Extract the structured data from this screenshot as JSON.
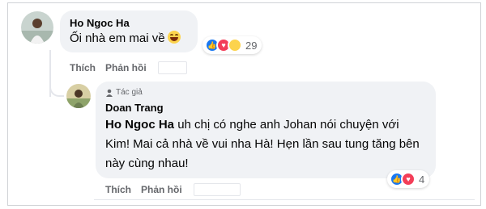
{
  "comment1": {
    "author": "Ho Ngoc Ha",
    "text": "Ối nhà em mai về",
    "emoji": "rolling-laughing-emoji",
    "reactions": [
      "like",
      "love",
      "haha"
    ],
    "reaction_count": "29",
    "actions": {
      "like": "Thích",
      "reply": "Phản hồi"
    }
  },
  "comment2": {
    "badge": "Tác giả",
    "author": "Doan Trang",
    "mention": "Ho Ngoc Ha",
    "text": "uh chị có nghe anh Johan nói chuyện với Kim! Mai cả nhà về vui nha Hà! Hẹn lần sau tung tăng bên này cùng nhau!",
    "reactions": [
      "like",
      "love"
    ],
    "reaction_count": "4",
    "actions": {
      "like": "Thích",
      "reply": "Phản hồi"
    }
  },
  "colors": {
    "bubble": "#f0f2f5",
    "like": "#1877f2",
    "love": "#f33e58",
    "secondary_text": "#65676b"
  }
}
